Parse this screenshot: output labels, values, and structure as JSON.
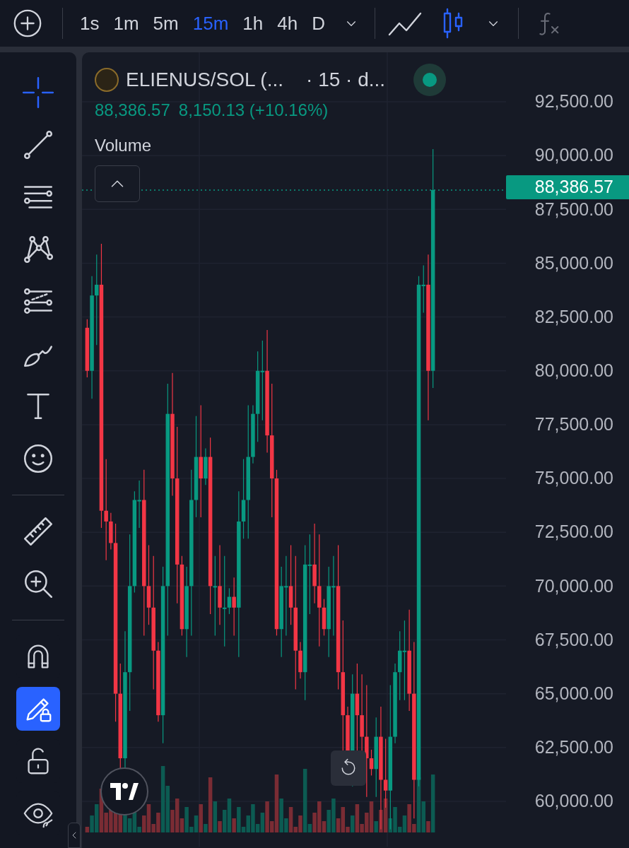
{
  "toolbar": {
    "intervals": [
      {
        "label": "1s",
        "selected": false
      },
      {
        "label": "1m",
        "selected": false
      },
      {
        "label": "5m",
        "selected": false
      },
      {
        "label": "15m",
        "selected": true
      },
      {
        "label": "1h",
        "selected": false
      },
      {
        "label": "4h",
        "selected": false
      },
      {
        "label": "D",
        "selected": false
      }
    ],
    "chart_types": [
      {
        "kind": "line",
        "selected": false
      },
      {
        "kind": "candles",
        "selected": true
      }
    ]
  },
  "tool_groups": [
    {
      "tools": [
        {
          "kind": "crosshair",
          "selected": true
        },
        {
          "kind": "trend-line",
          "selected": false
        },
        {
          "kind": "horizontal-lines",
          "selected": false
        },
        {
          "kind": "pattern",
          "selected": false
        },
        {
          "kind": "fib",
          "selected": false
        },
        {
          "kind": "brush",
          "selected": false
        },
        {
          "kind": "text",
          "selected": false
        },
        {
          "kind": "emoji",
          "selected": false
        }
      ]
    },
    {
      "tools": [
        {
          "kind": "ruler",
          "selected": false
        },
        {
          "kind": "zoom",
          "selected": false
        }
      ]
    }
  ],
  "toggles": [
    {
      "kind": "magnet",
      "on": false
    },
    {
      "kind": "lock-drawings",
      "on": true
    },
    {
      "kind": "lock",
      "on": false
    },
    {
      "kind": "eye",
      "on": false
    }
  ],
  "legend": {
    "symbol": "ELIENUS/SOL (...",
    "interval": "· 15 · d...",
    "price": "88,386.57",
    "change": "8,150.13 (+10.16%)",
    "indicator": "Volume",
    "market_open": true
  },
  "price_axis": {
    "labels": [
      "92,500.00",
      "90,000.00",
      "87,500.00",
      "85,000.00",
      "82,500.00",
      "80,000.00",
      "77,500.00",
      "75,000.00",
      "72,500.00",
      "70,000.00",
      "67,500.00",
      "65,000.00",
      "62,500.00",
      "60,000.00"
    ],
    "last_price": "88,386.57"
  }
}
